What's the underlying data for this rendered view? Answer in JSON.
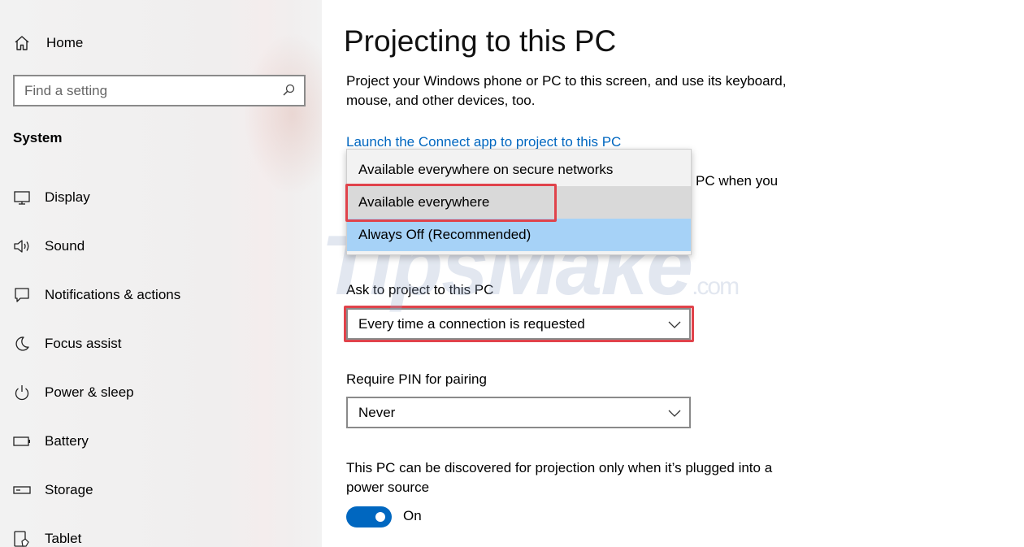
{
  "sidebar": {
    "home_label": "Home",
    "search_placeholder": "Find a setting",
    "section_title": "System",
    "items": [
      {
        "label": "Display",
        "icon": "display-icon"
      },
      {
        "label": "Sound",
        "icon": "sound-icon"
      },
      {
        "label": "Notifications & actions",
        "icon": "notifications-icon"
      },
      {
        "label": "Focus assist",
        "icon": "focus-assist-icon"
      },
      {
        "label": "Power & sleep",
        "icon": "power-icon"
      },
      {
        "label": "Battery",
        "icon": "battery-icon"
      },
      {
        "label": "Storage",
        "icon": "storage-icon"
      },
      {
        "label": "Tablet",
        "icon": "tablet-icon"
      }
    ]
  },
  "main": {
    "title": "Projecting to this PC",
    "description": "Project your Windows phone or PC to this screen, and use its keyboard, mouse, and other devices, too.",
    "link": "Launch the Connect app to project to this PC",
    "partial_text": "PC when you",
    "dropdown_options": [
      "Available everywhere on secure networks",
      "Available everywhere",
      "Always Off (Recommended)"
    ],
    "ask_label": "Ask to project to this PC",
    "ask_value": "Every time a connection is requested",
    "pin_label": "Require PIN for pairing",
    "pin_value": "Never",
    "discover_text": "This PC can be discovered for projection only when it’s plugged into a power source",
    "toggle_state": "On"
  },
  "colors": {
    "accent": "#0067c0",
    "highlight_border": "#e0434b",
    "selected_option": "#a6d2f7"
  },
  "watermark": {
    "text": "TipsMake",
    "suffix": ".com"
  }
}
